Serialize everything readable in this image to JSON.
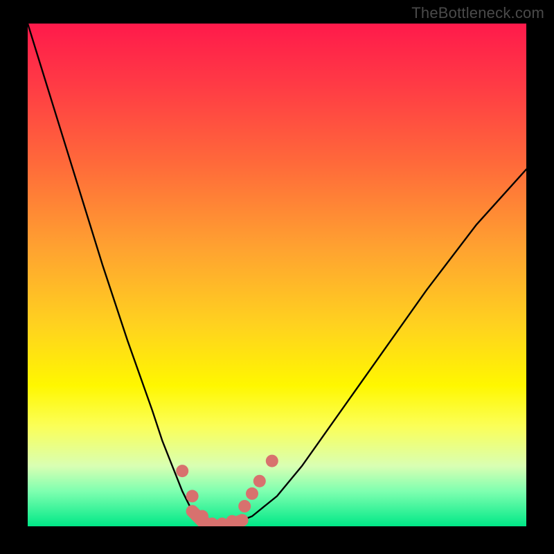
{
  "watermark": "TheBottleneck.com",
  "chart_data": {
    "type": "line",
    "title": "",
    "xlabel": "",
    "ylabel": "",
    "xlim": [
      0,
      100
    ],
    "ylim": [
      0,
      100
    ],
    "curve": {
      "name": "bottleneck-curve",
      "x": [
        0,
        5,
        10,
        15,
        20,
        25,
        27,
        29,
        31,
        33,
        35,
        37,
        40,
        45,
        50,
        55,
        60,
        70,
        80,
        90,
        100
      ],
      "y": [
        100,
        84,
        68,
        52,
        37,
        23,
        17,
        12,
        7,
        3,
        1,
        0,
        0,
        2,
        6,
        12,
        19,
        33,
        47,
        60,
        71
      ]
    },
    "markers": {
      "name": "highlight-dots",
      "color": "#d8716e",
      "points": [
        {
          "x": 31,
          "y": 11
        },
        {
          "x": 33,
          "y": 6
        },
        {
          "x": 35,
          "y": 2
        },
        {
          "x": 37,
          "y": 0.5
        },
        {
          "x": 39,
          "y": 0.5
        },
        {
          "x": 41,
          "y": 1
        },
        {
          "x": 43.5,
          "y": 4
        },
        {
          "x": 45,
          "y": 6.5
        },
        {
          "x": 46.5,
          "y": 9
        },
        {
          "x": 49,
          "y": 13
        }
      ]
    }
  }
}
